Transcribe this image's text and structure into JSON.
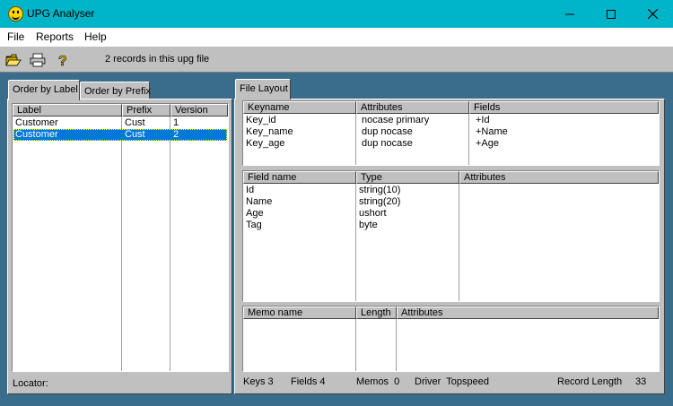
{
  "window": {
    "title": "UPG Analyser"
  },
  "menu": {
    "items": [
      "File",
      "Reports",
      "Help"
    ]
  },
  "toolbar": {
    "status": "2 records in this upg file",
    "icons": [
      "open-folder-icon",
      "printer-icon",
      "help-icon"
    ]
  },
  "left": {
    "tabs": [
      "Order by Label",
      "Order by Prefix"
    ],
    "columns": [
      "Label",
      "Prefix",
      "Version"
    ],
    "rows": [
      [
        "Customer",
        "Cust",
        "1"
      ],
      [
        "Customer",
        "Cust",
        "2"
      ]
    ],
    "locator_label": "Locator:"
  },
  "right": {
    "tab": "File Layout",
    "keys": {
      "columns": [
        "Keyname",
        "Attributes",
        "Fields"
      ],
      "rows": [
        [
          "Key_id",
          "nocase primary",
          "+Id"
        ],
        [
          "Key_name",
          "dup nocase",
          "+Name"
        ],
        [
          "Key_age",
          "dup nocase",
          "+Age"
        ]
      ]
    },
    "fields": {
      "columns": [
        "Field name",
        "Type",
        "Attributes"
      ],
      "rows": [
        [
          "Id",
          "string(10)",
          ""
        ],
        [
          "Name",
          "string(20)",
          ""
        ],
        [
          "Age",
          "ushort",
          ""
        ],
        [
          "Tag",
          "byte",
          ""
        ]
      ]
    },
    "memos": {
      "columns": [
        "Memo name",
        "Length",
        "Attributes"
      ]
    },
    "status": {
      "keys": "Keys 3",
      "fields": "Fields 4",
      "memos": "Memos  0",
      "driver": "Driver  Topspeed",
      "record_length_label": "Record Length",
      "record_length_value": "33"
    }
  },
  "colors": {
    "titlebar": "#00b4c8",
    "background": "#3a6c8c",
    "selection": "#0078d7"
  }
}
